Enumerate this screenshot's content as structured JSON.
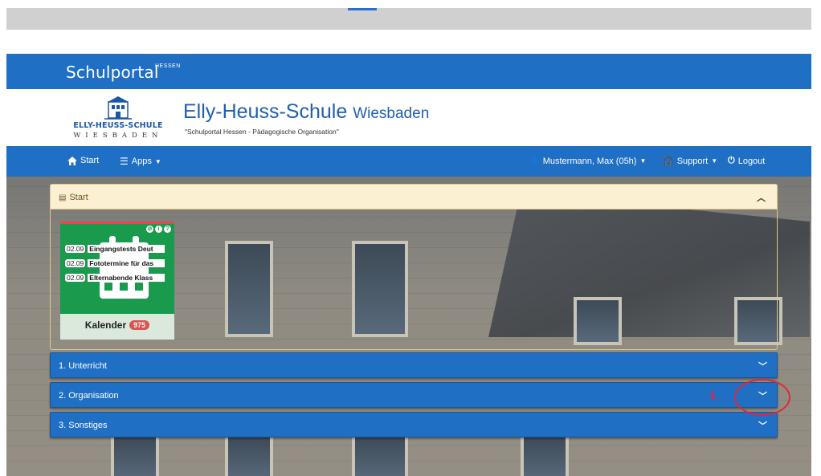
{
  "portal": {
    "name": "Schulportal",
    "superscript": "HESSEN"
  },
  "school": {
    "logo_name": "ELLY-HEUSS-SCHULE",
    "logo_city": "WIESBADEN",
    "name": "Elly-Heuss-Schule",
    "city": "Wiesbaden",
    "subtitle": "\"Schulportal Hessen - Pädagogische Organisation\""
  },
  "nav": {
    "start": "Start",
    "apps": "Apps",
    "user": "Mustermann, Max (05h)",
    "support": "Support",
    "logout": "Logout"
  },
  "start_panel": {
    "title": "Start",
    "tile": {
      "label": "Kalender",
      "badge": "975",
      "events": [
        {
          "date": "02.09",
          "text": "Eingangstests Deut"
        },
        {
          "date": "02.09",
          "text": "Fototermine für das"
        },
        {
          "date": "02.09",
          "text": "Elternabende Klass"
        }
      ]
    }
  },
  "sections": [
    {
      "label": "1. Unterricht"
    },
    {
      "label": "2. Organisation"
    },
    {
      "label": "3. Sonstiges"
    }
  ],
  "annotation": {
    "step": "4."
  },
  "colors": {
    "brand_blue": "#1f6fc5",
    "tile_green": "#199a4c",
    "panel_bg": "#fcf0d2",
    "annotation_red": "#e0263a"
  }
}
